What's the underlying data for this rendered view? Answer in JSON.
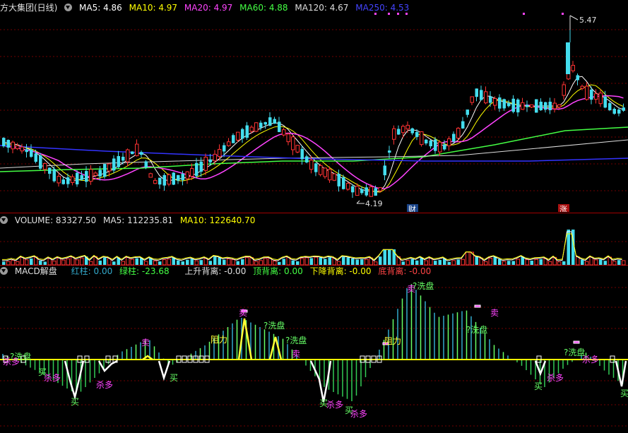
{
  "price_panel": {
    "title": "方大集团(日线)",
    "indicators": [
      {
        "label": "MA5: 4.86",
        "color": "#ffffff"
      },
      {
        "label": "MA10: 4.97",
        "color": "#ffff00"
      },
      {
        "label": "MA20: 4.97",
        "color": "#ff44ff"
      },
      {
        "label": "MA60: 4.88",
        "color": "#44ff44"
      },
      {
        "label": "MA120: 4.67",
        "color": "#dddddd"
      },
      {
        "label": "MA250: 4.53",
        "color": "#3333ff"
      }
    ],
    "high_label": "5.47",
    "low_label": "4.19",
    "markers": {
      "cai": "财",
      "zhang": "涨"
    }
  },
  "volume_panel": {
    "indicators": [
      {
        "label": "VOLUME: 83327.50",
        "color": "#e0e0e0"
      },
      {
        "label": "MA5: 112235.81",
        "color": "#e0e0e0"
      },
      {
        "label": "MA10: 122640.70",
        "color": "#ffff00"
      }
    ]
  },
  "macd_panel": {
    "indicators": [
      {
        "label": "MACD解盘",
        "color": "#e0e0e0"
      },
      {
        "label": "红柱: 0.00",
        "color": "#33aacc"
      },
      {
        "label": "绿柱: -23.68",
        "color": "#44ff44"
      },
      {
        "label": "上升背离: -0.00",
        "color": "#e0e0e0"
      },
      {
        "label": "顶背离: 0.00",
        "color": "#44ff44"
      },
      {
        "label": "下降背离: -0.00",
        "color": "#ffff00"
      },
      {
        "label": "底背离: -0.00",
        "color": "#ff4444"
      }
    ],
    "annotations": {
      "sell": "卖",
      "buy": "买",
      "kill_long": "杀多",
      "wash": "?洗盘",
      "resist": "阻力"
    }
  },
  "colors": {
    "up": "#ff3333",
    "down": "#44ddee",
    "axis": "#a00000",
    "ma5": "#ffffff",
    "ma10": "#ffff00",
    "ma20": "#ff44ff",
    "ma60": "#44ff44",
    "ma120": "#dddddd",
    "ma250": "#3333ff"
  }
}
